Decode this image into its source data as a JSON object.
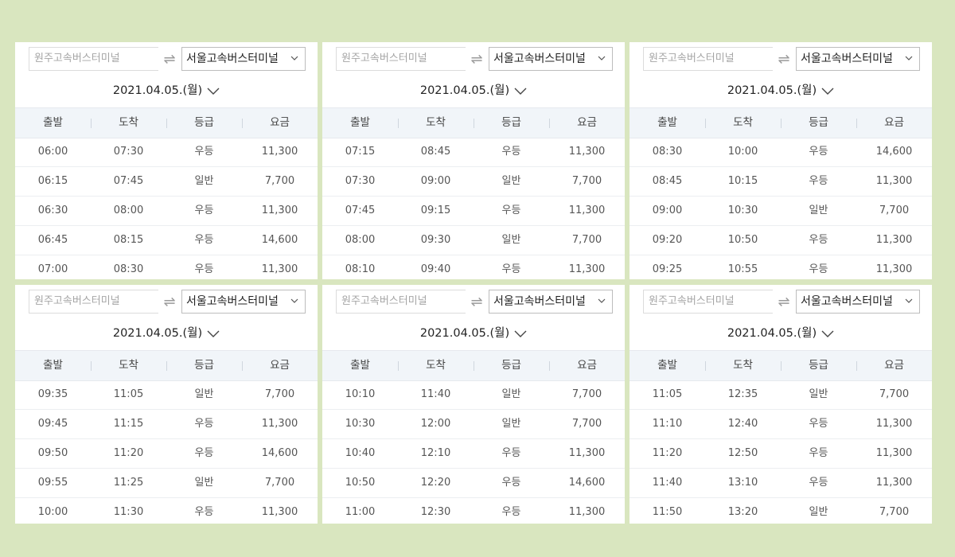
{
  "panels": [
    {
      "from_placeholder": "원주고속버스터미널",
      "to_value": "서울고속버스터미널",
      "date": "2021.04.05.(월)",
      "headers": [
        "출발",
        "도착",
        "등급",
        "요금"
      ],
      "rows": [
        {
          "dep": "06:00",
          "arr": "07:30",
          "grade": "우등",
          "fare": "11,300"
        },
        {
          "dep": "06:15",
          "arr": "07:45",
          "grade": "일반",
          "fare": "7,700"
        },
        {
          "dep": "06:30",
          "arr": "08:00",
          "grade": "우등",
          "fare": "11,300"
        },
        {
          "dep": "06:45",
          "arr": "08:15",
          "grade": "우등",
          "fare": "14,600"
        },
        {
          "dep": "07:00",
          "arr": "08:30",
          "grade": "우등",
          "fare": "11,300"
        }
      ]
    },
    {
      "from_placeholder": "원주고속버스터미널",
      "to_value": "서울고속버스터미널",
      "date": "2021.04.05.(월)",
      "headers": [
        "출발",
        "도착",
        "등급",
        "요금"
      ],
      "rows": [
        {
          "dep": "07:15",
          "arr": "08:45",
          "grade": "우등",
          "fare": "11,300"
        },
        {
          "dep": "07:30",
          "arr": "09:00",
          "grade": "일반",
          "fare": "7,700"
        },
        {
          "dep": "07:45",
          "arr": "09:15",
          "grade": "우등",
          "fare": "11,300"
        },
        {
          "dep": "08:00",
          "arr": "09:30",
          "grade": "일반",
          "fare": "7,700"
        },
        {
          "dep": "08:10",
          "arr": "09:40",
          "grade": "우등",
          "fare": "11,300"
        }
      ]
    },
    {
      "from_placeholder": "원주고속버스터미널",
      "to_value": "서울고속버스터미널",
      "date": "2021.04.05.(월)",
      "headers": [
        "출발",
        "도착",
        "등급",
        "요금"
      ],
      "rows": [
        {
          "dep": "08:30",
          "arr": "10:00",
          "grade": "우등",
          "fare": "14,600"
        },
        {
          "dep": "08:45",
          "arr": "10:15",
          "grade": "우등",
          "fare": "11,300"
        },
        {
          "dep": "09:00",
          "arr": "10:30",
          "grade": "일반",
          "fare": "7,700"
        },
        {
          "dep": "09:20",
          "arr": "10:50",
          "grade": "우등",
          "fare": "11,300"
        },
        {
          "dep": "09:25",
          "arr": "10:55",
          "grade": "우등",
          "fare": "11,300"
        }
      ]
    },
    {
      "from_placeholder": "원주고속버스터미널",
      "to_value": "서울고속버스터미널",
      "date": "2021.04.05.(월)",
      "headers": [
        "출발",
        "도착",
        "등급",
        "요금"
      ],
      "rows": [
        {
          "dep": "09:35",
          "arr": "11:05",
          "grade": "일반",
          "fare": "7,700"
        },
        {
          "dep": "09:45",
          "arr": "11:15",
          "grade": "우등",
          "fare": "11,300"
        },
        {
          "dep": "09:50",
          "arr": "11:20",
          "grade": "우등",
          "fare": "14,600"
        },
        {
          "dep": "09:55",
          "arr": "11:25",
          "grade": "일반",
          "fare": "7,700"
        },
        {
          "dep": "10:00",
          "arr": "11:30",
          "grade": "우등",
          "fare": "11,300"
        }
      ]
    },
    {
      "from_placeholder": "원주고속버스터미널",
      "to_value": "서울고속버스터미널",
      "date": "2021.04.05.(월)",
      "headers": [
        "출발",
        "도착",
        "등급",
        "요금"
      ],
      "rows": [
        {
          "dep": "10:10",
          "arr": "11:40",
          "grade": "일반",
          "fare": "7,700"
        },
        {
          "dep": "10:30",
          "arr": "12:00",
          "grade": "일반",
          "fare": "7,700"
        },
        {
          "dep": "10:40",
          "arr": "12:10",
          "grade": "우등",
          "fare": "11,300"
        },
        {
          "dep": "10:50",
          "arr": "12:20",
          "grade": "우등",
          "fare": "14,600"
        },
        {
          "dep": "11:00",
          "arr": "12:30",
          "grade": "우등",
          "fare": "11,300"
        }
      ]
    },
    {
      "from_placeholder": "원주고속버스터미널",
      "to_value": "서울고속버스터미널",
      "date": "2021.04.05.(월)",
      "headers": [
        "출발",
        "도착",
        "등급",
        "요금"
      ],
      "rows": [
        {
          "dep": "11:05",
          "arr": "12:35",
          "grade": "일반",
          "fare": "7,700"
        },
        {
          "dep": "11:10",
          "arr": "12:40",
          "grade": "우등",
          "fare": "11,300"
        },
        {
          "dep": "11:20",
          "arr": "12:50",
          "grade": "우등",
          "fare": "11,300"
        },
        {
          "dep": "11:40",
          "arr": "13:10",
          "grade": "우등",
          "fare": "11,300"
        },
        {
          "dep": "11:50",
          "arr": "13:20",
          "grade": "일반",
          "fare": "7,700"
        }
      ]
    }
  ]
}
